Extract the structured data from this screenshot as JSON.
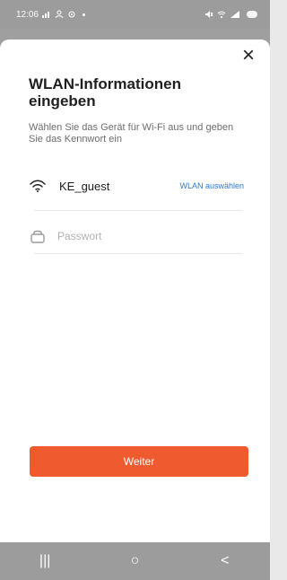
{
  "status_bar": {
    "time": "12:06",
    "left_icons": [
      "signal-icon",
      "contact-icon",
      "settings-icon",
      "dot-icon"
    ],
    "right_icons": [
      "mute-icon",
      "wifi-icon",
      "signal-strength-icon",
      "battery-icon"
    ]
  },
  "dialog": {
    "close_label": "×",
    "title": "WLAN-Informationen eingeben",
    "subtitle": "Wählen Sie das Gerät für Wi-Fi aus und geben Sie das Kennwort ein",
    "wifi": {
      "ssid": "KE_guest",
      "select_link": "WLAN auswählen",
      "icon": "wifi-icon"
    },
    "password": {
      "placeholder": "Passwort",
      "value": "",
      "icon": "lock-icon"
    },
    "primary_button_label": "Weiter"
  },
  "navigation_bar": {
    "recent_label": "|||",
    "home_label": "○",
    "back_label": "<"
  },
  "colors": {
    "accent": "#f05a2f",
    "link": "#2c7bd0",
    "overlay": "#9c9c9c"
  }
}
